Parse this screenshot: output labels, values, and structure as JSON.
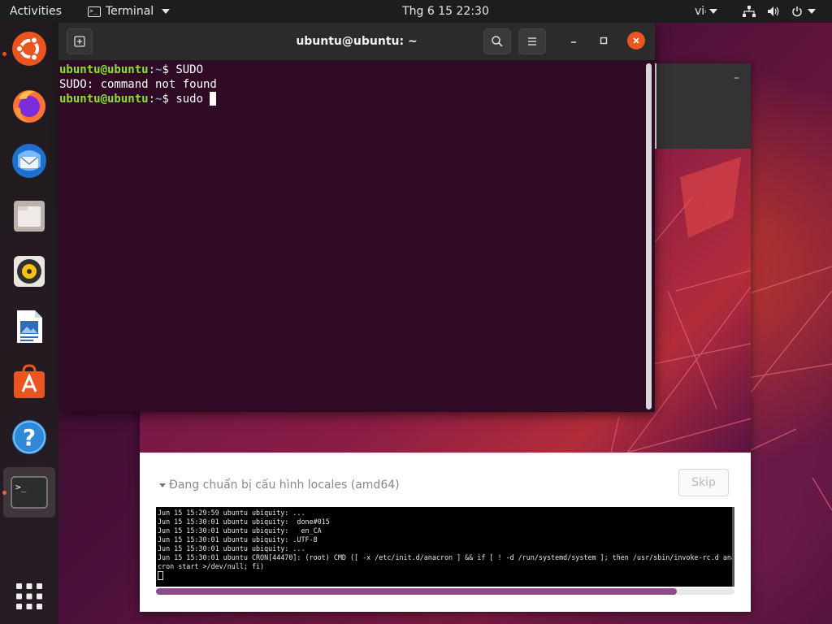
{
  "topbar": {
    "activities": "Activities",
    "app_name": "Terminal",
    "clock": "Thg 6 15  22:30",
    "input_lang": "vi"
  },
  "dock": {
    "items": [
      {
        "name": "ubiquity-installer",
        "icon": "ubuntu-installer-icon"
      },
      {
        "name": "firefox",
        "icon": "firefox-icon"
      },
      {
        "name": "thunderbird",
        "icon": "thunderbird-icon"
      },
      {
        "name": "files",
        "icon": "files-icon"
      },
      {
        "name": "rhythmbox",
        "icon": "rhythmbox-icon"
      },
      {
        "name": "libreoffice-writer",
        "icon": "writer-icon"
      },
      {
        "name": "ubuntu-software",
        "icon": "software-icon"
      },
      {
        "name": "help",
        "icon": "help-icon",
        "glyph": "?"
      },
      {
        "name": "terminal",
        "icon": "terminal-icon",
        "glyph": ">_"
      },
      {
        "name": "show-applications",
        "icon": "app-grid-icon"
      }
    ]
  },
  "terminal": {
    "title": "ubuntu@ubuntu: ~",
    "lines": [
      {
        "user": "ubuntu@ubuntu",
        "sep": ":",
        "path": "~",
        "prompt": "$ ",
        "cmd": "SUDO"
      },
      {
        "text": "SUDO: command not found"
      },
      {
        "user": "ubuntu@ubuntu",
        "sep": ":",
        "path": "~",
        "prompt": "$ ",
        "cmd": "sudo "
      }
    ]
  },
  "installer": {
    "status": "Đang chuẩn bị  cấu hình locales (amd64)",
    "skip_label": "Skip",
    "progress": 0.9,
    "log_lines": [
      "Jun 15 15:29:59 ubuntu ubiquity: ...",
      "Jun 15 15:30:01 ubuntu ubiquity:  done#015",
      "Jun 15 15:30:01 ubuntu ubiquity:   en_CA",
      "Jun 15 15:30:01 ubuntu ubiquity: .UTF-8",
      "Jun 15 15:30:01 ubuntu ubiquity: ...",
      "Jun 15 15:30:01 ubuntu CRON[44470]: (root) CMD ([ -x /etc/init.d/anacron ] && if [ ! -d /run/systemd/system ]; then /usr/sbin/invoke-rc.d ana",
      "cron start >/dev/null; fi)"
    ]
  },
  "colors": {
    "accent": "#e95420",
    "terminal_bg": "#300a24",
    "prompt_user": "#8ae234",
    "prompt_path": "#729fcf"
  }
}
